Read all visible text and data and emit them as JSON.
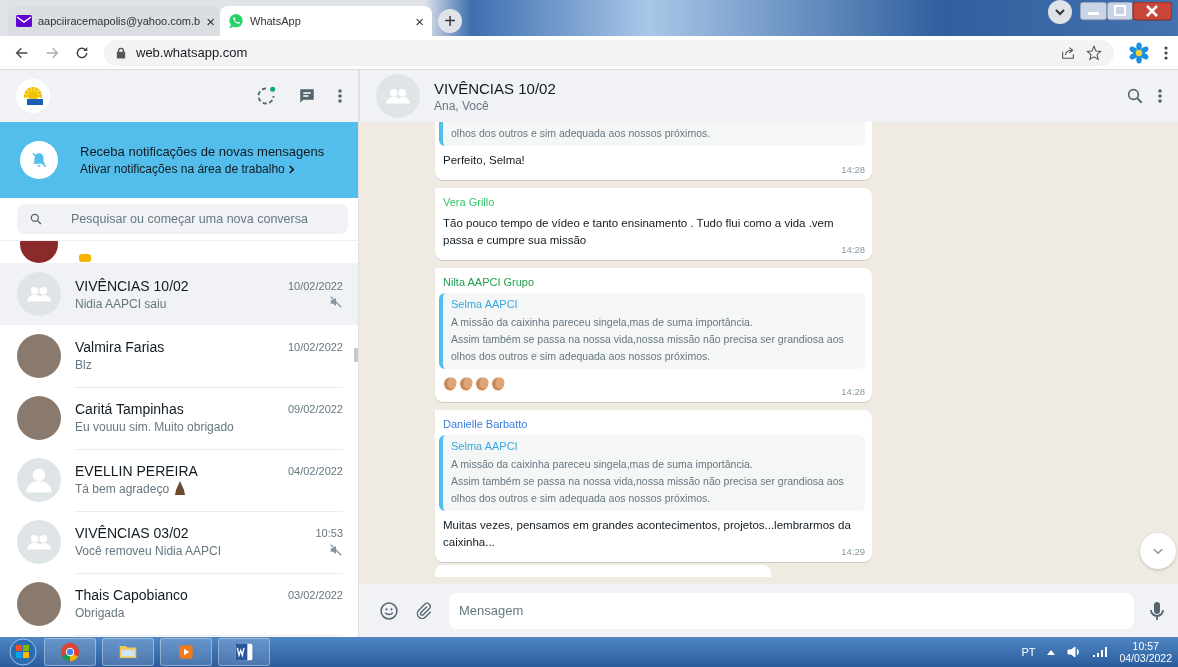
{
  "browser": {
    "tabs": [
      {
        "title": "aapciiracemapolis@yahoo.com.b",
        "selected": false,
        "close": "×"
      },
      {
        "title": "WhatsApp",
        "selected": true,
        "close": "×"
      }
    ],
    "new_tab": "+",
    "url": "web.whatsapp.com"
  },
  "sidebar": {
    "notification": {
      "title": "Receba notificações de novas mensagens",
      "link": "Ativar notificações na área de trabalho"
    },
    "search": {
      "placeholder": "Pesquisar ou começar uma nova conversa"
    },
    "chats": [
      {
        "name": "VIVÊNCIAS 10/02",
        "preview": "Nidia AAPCI saiu",
        "time": "10/02/2022",
        "kind": "group",
        "emoji": false,
        "muted": true,
        "selected": true
      },
      {
        "name": "Valmira Farias",
        "preview": "Blz",
        "time": "10/02/2022",
        "kind": "photo",
        "emoji": false,
        "muted": false,
        "selected": false
      },
      {
        "name": "Caritá Tampinhas",
        "preview": "Eu vouuu sim. Muito obrigado",
        "time": "09/02/2022",
        "kind": "photo",
        "emoji": false,
        "muted": false,
        "selected": false
      },
      {
        "name": "EVELLIN PEREIRA",
        "preview": "Tá bem agradeço",
        "emoji": true,
        "time": "04/02/2022",
        "kind": "person",
        "muted": false,
        "selected": false
      },
      {
        "name": "VIVÊNCIAS 03/02",
        "preview": "Você removeu Nidia AAPCI",
        "time": "10:53",
        "kind": "group",
        "emoji": false,
        "muted": true,
        "selected": false
      },
      {
        "name": "Thais Capobianco",
        "preview": "Obrigada",
        "time": "03/02/2022",
        "kind": "photo",
        "emoji": false,
        "muted": false,
        "selected": false
      }
    ]
  },
  "chat": {
    "title": "VIVÊNCIAS 10/02",
    "subtitle": "Ana, Você",
    "messages": [
      {
        "kind": "text",
        "quote": {
          "text": "olhos dos outros e sim adequada aos nossos próximos."
        },
        "text": "Perfeito, Selma!",
        "time": "14:28"
      },
      {
        "kind": "text",
        "sender": "Vera Grillo",
        "color": "#35c46a",
        "text": "Tão pouco tempo de vídeo e tanto ensinamento . Tudo flui como a vida .vem passa e cumpre sua missão",
        "time": "14:28"
      },
      {
        "kind": "claps",
        "sender": "Nilta AAPCI Grupo",
        "color": "#1f9e4f",
        "quote": {
          "author": "Selma AAPCI",
          "text": "A missão da caixinha pareceu singela,mas de suma importância.\nAssim também se passa na nossa vida,nossa missão não precisa ser grandiosa aos olhos dos outros e sim adequada aos nossos próximos."
        },
        "time": "14:28"
      },
      {
        "kind": "text",
        "sender": "Danielle Barbatto",
        "color": "#3b7de0",
        "quote": {
          "author": "Selma AAPCI",
          "text": "A missão da caixinha pareceu singela,mas de suma importância.\nAssim também se passa na nossa vida,nossa missão não precisa ser grandiosa aos olhos dos outros e sim adequada aos nossos próximos."
        },
        "text": "Muitas vezes, pensamos em grandes acontecimentos, projetos...lembrarmos da caixinha...",
        "time": "14:29"
      }
    ],
    "composer": {
      "placeholder": "Mensagem"
    }
  },
  "taskbar": {
    "language": "PT",
    "time": "10:57",
    "date": "04/03/2022"
  }
}
